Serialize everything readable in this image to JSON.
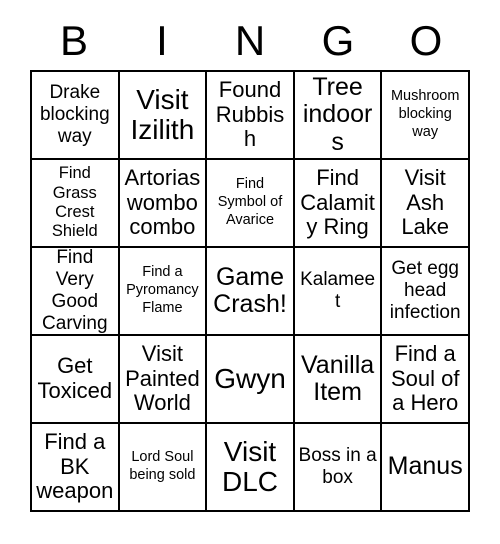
{
  "card": {
    "title": "BINGO",
    "header_letters": [
      "B",
      "I",
      "N",
      "G",
      "O"
    ],
    "grid_size": "5x5",
    "colors": {
      "background": "#ffffff",
      "text": "#000000",
      "border": "#000000"
    },
    "cells": [
      {
        "text": "Drake blocking way",
        "size": "m"
      },
      {
        "text": "Visit Izilith",
        "size": "xxl"
      },
      {
        "text": "Found Rubbish",
        "size": "l"
      },
      {
        "text": "Tree indoors",
        "size": "xl"
      },
      {
        "text": "Mushroom blocking way",
        "size": "xs"
      },
      {
        "text": "Find Grass Crest Shield",
        "size": "s"
      },
      {
        "text": "Artorias wombo combo",
        "size": "l"
      },
      {
        "text": "Find Symbol of Avarice",
        "size": "xs"
      },
      {
        "text": "Find Calamity Ring",
        "size": "l"
      },
      {
        "text": "Visit Ash Lake",
        "size": "l"
      },
      {
        "text": "Find Very Good Carving",
        "size": "m"
      },
      {
        "text": "Find a Pyromancy Flame",
        "size": "xs"
      },
      {
        "text": "Game Crash!",
        "size": "xl"
      },
      {
        "text": "Kalameet",
        "size": "m"
      },
      {
        "text": "Get egg head infection",
        "size": "m"
      },
      {
        "text": "Get Toxiced",
        "size": "l"
      },
      {
        "text": "Visit Painted World",
        "size": "l"
      },
      {
        "text": "Gwyn",
        "size": "xxl"
      },
      {
        "text": "Vanilla Item",
        "size": "xl"
      },
      {
        "text": "Find a Soul of a Hero",
        "size": "l"
      },
      {
        "text": "Find a BK weapon",
        "size": "l"
      },
      {
        "text": "Lord Soul being sold",
        "size": "xs"
      },
      {
        "text": "Visit DLC",
        "size": "xxl"
      },
      {
        "text": "Boss in a box",
        "size": "m"
      },
      {
        "text": "Manus",
        "size": "xl"
      }
    ]
  }
}
